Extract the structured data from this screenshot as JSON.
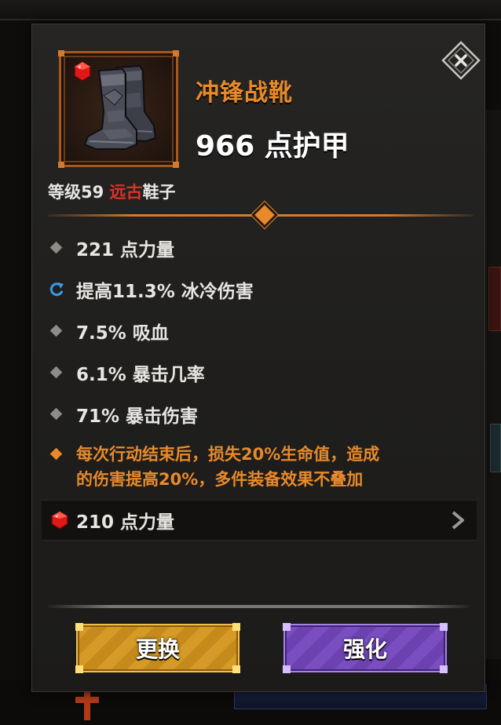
{
  "item": {
    "name": "冲锋战靴",
    "armor": "966 点护甲",
    "level_prefix": "等级59 ",
    "rarity": "远古",
    "slot": "鞋子",
    "icon": "boots-icon",
    "has_socket_gem": true
  },
  "stats": [
    {
      "icon": "diamond-icon",
      "text": "221 点力量"
    },
    {
      "icon": "reroll-icon",
      "text": "提高11.3% 冰冷伤害"
    },
    {
      "icon": "diamond-icon",
      "text": "7.5% 吸血"
    },
    {
      "icon": "diamond-icon",
      "text": "6.1% 暴击几率"
    },
    {
      "icon": "diamond-icon",
      "text": "71% 暴击伤害"
    }
  ],
  "legendary_affix": {
    "icon": "orange-diamond-icon",
    "line1": "每次行动结束后，损失20%生命值，造成",
    "line2": "的伤害提高20%，多件装备效果不叠加"
  },
  "gem": {
    "icon": "ruby-gem-icon",
    "text": "210 点力量"
  },
  "buttons": {
    "swap_label": "更换",
    "enhance_label": "强化"
  },
  "colors": {
    "legendary_orange": "#e88a2a",
    "ancient_red": "#e03028",
    "swap_gold": "#d69a26",
    "enhance_purple": "#7a4ec0",
    "reroll_blue": "#3a9ae8"
  }
}
